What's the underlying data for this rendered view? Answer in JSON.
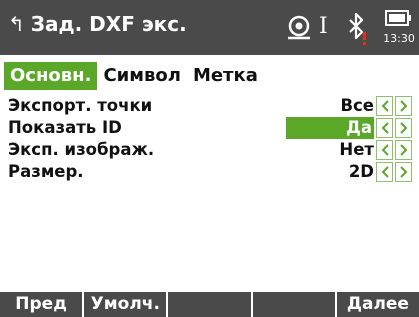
{
  "header": {
    "back_glyph": "↰",
    "title": "Зад. DXF экс.",
    "input_mode": "I",
    "time": "13:30",
    "icons": [
      "survey-target-icon",
      "bluetooth-warning-icon",
      "battery-icon"
    ],
    "accent_color": "#5ba829",
    "bar_color": "#4a4a4a"
  },
  "tabs": [
    {
      "label": "Основн.",
      "active": true
    },
    {
      "label": "Символ",
      "active": false
    },
    {
      "label": "Метка",
      "active": false
    }
  ],
  "rows": [
    {
      "label": "Экспорт. точки",
      "value": "Все"
    },
    {
      "label": "Показать ID",
      "value": "Да"
    },
    {
      "label": "Эксп. изображ.",
      "value": "Нет"
    },
    {
      "label": "Размер.",
      "value": "2D"
    }
  ],
  "fkeys": [
    "Пред",
    "Умолч.",
    "",
    "",
    "Далее"
  ]
}
